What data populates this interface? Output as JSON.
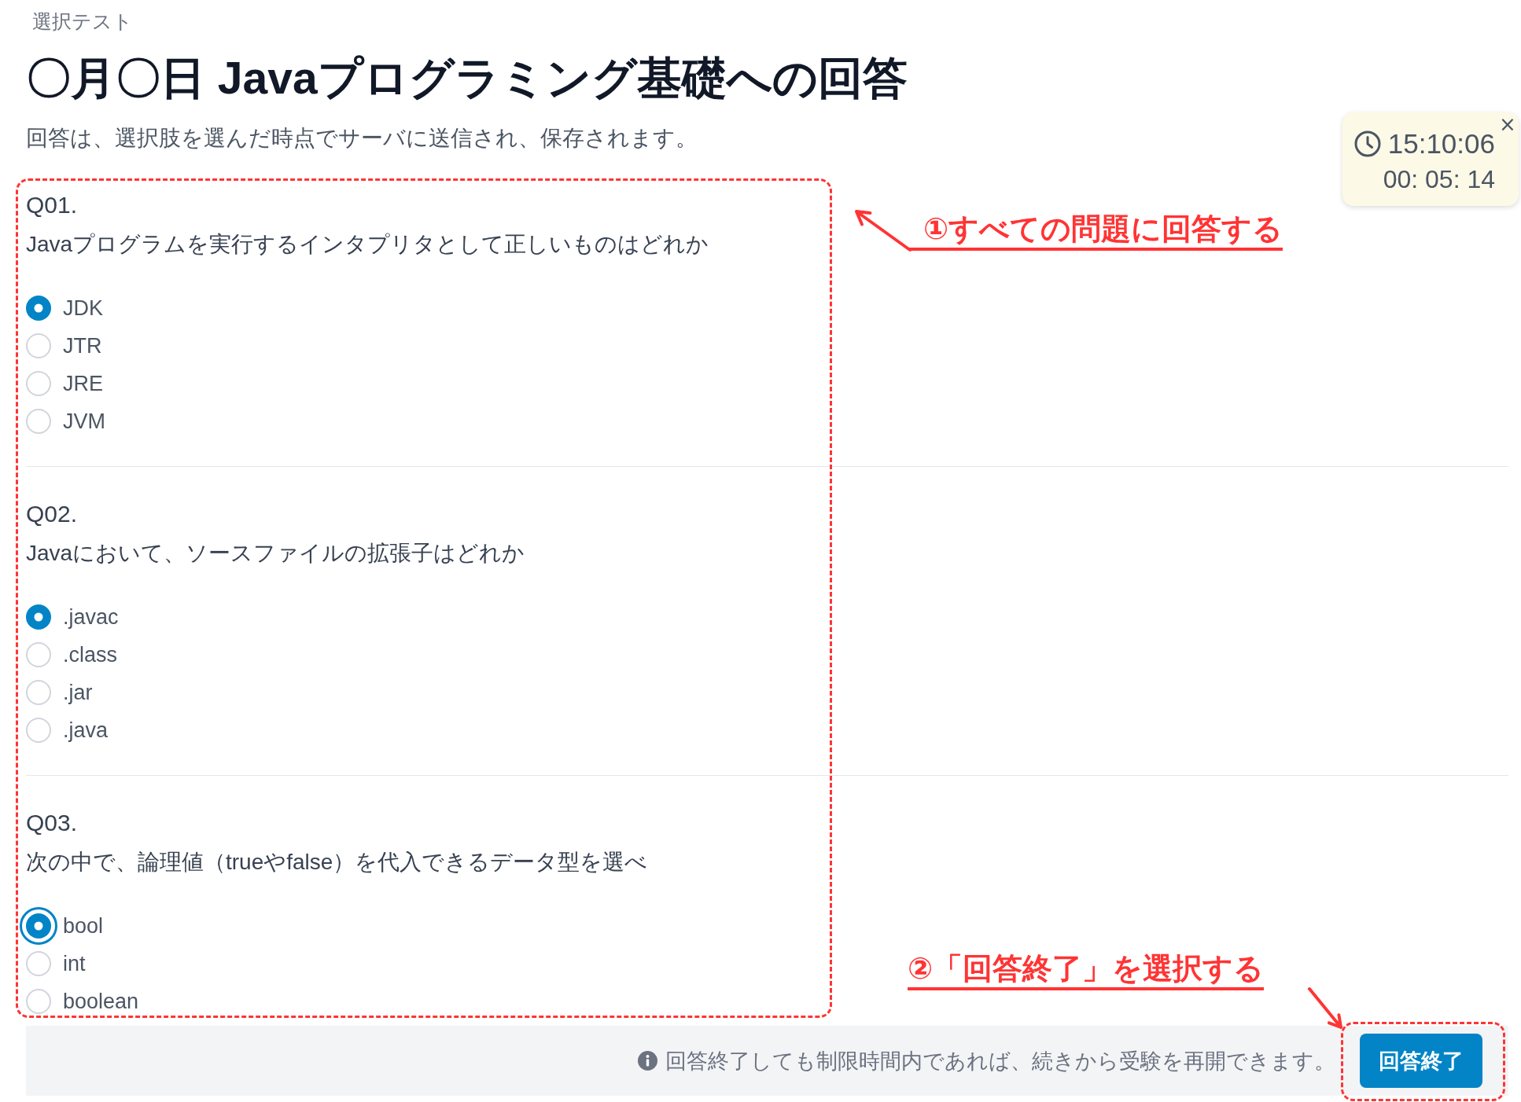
{
  "breadcrumb": "選択テスト",
  "title": "〇月〇日 Javaプログラミング基礎への回答",
  "description": "回答は、選択肢を選んだ時点でサーバに送信され、保存されます。",
  "timer": {
    "clock": "15:10:06",
    "elapsed": "00: 05: 14",
    "close": "×"
  },
  "questions": [
    {
      "number": "Q01.",
      "text": "Javaプログラムを実行するインタプリタとして正しいものはどれか",
      "options": [
        {
          "label": "JDK",
          "selected": true,
          "focused": false
        },
        {
          "label": "JTR",
          "selected": false,
          "focused": false
        },
        {
          "label": "JRE",
          "selected": false,
          "focused": false
        },
        {
          "label": "JVM",
          "selected": false,
          "focused": false
        }
      ]
    },
    {
      "number": "Q02.",
      "text": "Javaにおいて、ソースファイルの拡張子はどれか",
      "options": [
        {
          "label": ".javac",
          "selected": true,
          "focused": false
        },
        {
          "label": ".class",
          "selected": false,
          "focused": false
        },
        {
          "label": ".jar",
          "selected": false,
          "focused": false
        },
        {
          "label": ".java",
          "selected": false,
          "focused": false
        }
      ]
    },
    {
      "number": "Q03.",
      "text": "次の中で、論理値（trueやfalse）を代入できるデータ型を選べ",
      "options": [
        {
          "label": "bool",
          "selected": true,
          "focused": true
        },
        {
          "label": "int",
          "selected": false,
          "focused": false
        },
        {
          "label": "boolean",
          "selected": false,
          "focused": false
        }
      ]
    }
  ],
  "footer": {
    "note": "回答終了しても制限時間内であれば、続きから受験を再開できます。",
    "button": "回答終了"
  },
  "annotations": [
    {
      "text": "①すべての問題に回答する"
    },
    {
      "text": "②「回答終了」を選択する"
    }
  ]
}
